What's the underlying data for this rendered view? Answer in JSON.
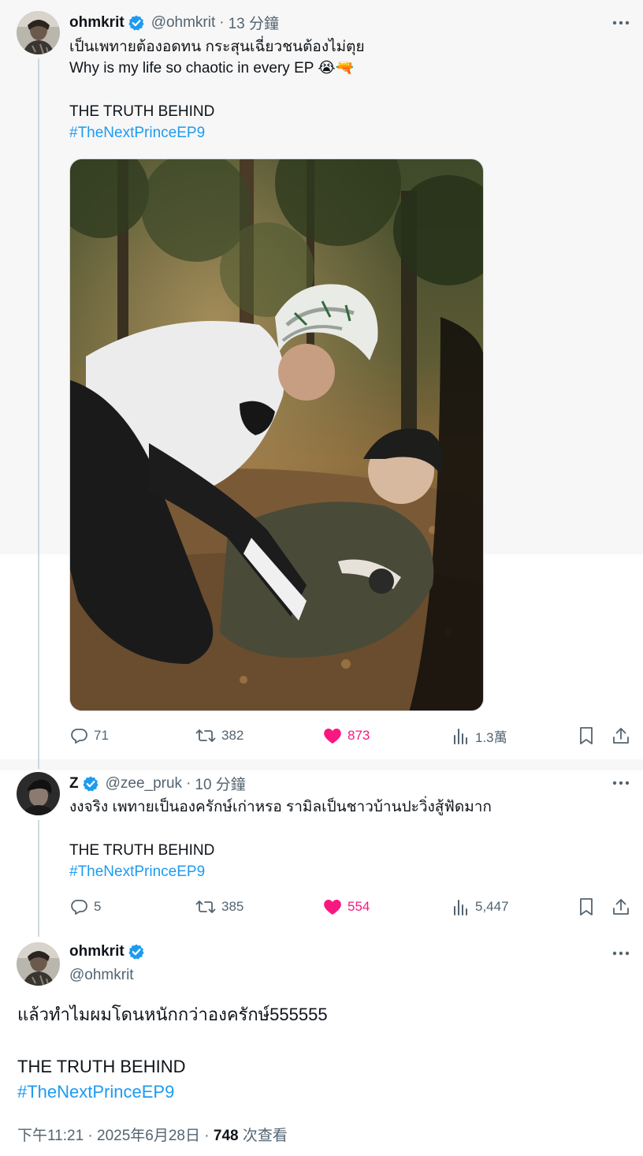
{
  "colors": {
    "accent": "#1d9bf0",
    "like": "#f91880",
    "muted": "#536471",
    "text": "#0f1419"
  },
  "tweet1": {
    "name": "ohmkrit",
    "handle": "@ohmkrit",
    "sep": "·",
    "time": "13 分鐘",
    "line1": "เป็นเพทายต้องอดทน กระสุนเฉี่ยวชนต้องไม่ตุย",
    "line2": "Why is my life so chaotic in every EP",
    "line2_emoji": "😭🔫",
    "line3": "THE TRUTH BEHIND",
    "hashtag": "#TheNextPrinceEP9",
    "media_icon": "photo-two-cyclists-in-forest",
    "stats": {
      "replies": "71",
      "retweets": "382",
      "likes": "873",
      "views": "1.3萬"
    }
  },
  "tweet2": {
    "name": "Z",
    "handle": "@zee_pruk",
    "sep": "·",
    "time": "10 分鐘",
    "line1": "งงจริง เพทายเป็นองครักษ์เก่าหรอ รามิลเป็นชาวบ้านปะวิ่งสู้ฟัดมาก",
    "line3": "THE TRUTH BEHIND",
    "hashtag": "#TheNextPrinceEP9",
    "stats": {
      "replies": "5",
      "retweets": "385",
      "likes": "554",
      "views": "5,447"
    }
  },
  "tweet3": {
    "name": "ohmkrit",
    "handle": "@ohmkrit",
    "line1": "แล้วทำไมผมโดนหนักกว่าองครักษ์555555",
    "line3": "THE TRUTH BEHIND",
    "hashtag": "#TheNextPrinceEP9",
    "datetime": "下午11:21 · 2025年6月28日 · ",
    "views_count": "748",
    "views_label": " 次查看"
  }
}
